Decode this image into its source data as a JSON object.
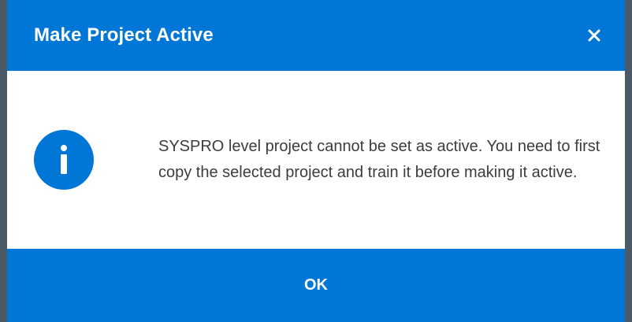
{
  "dialog": {
    "title": "Make Project Active",
    "close_icon": "close-icon",
    "info_icon": "info-icon",
    "message": "SYSPRO level project cannot be set as active. You need to first copy the selected project and train it before making it active.",
    "ok_label": "OK"
  },
  "colors": {
    "accent": "#0076d6",
    "text": "#3c3c3c",
    "header_text": "#ffffff",
    "backdrop": "#4b5a66"
  }
}
